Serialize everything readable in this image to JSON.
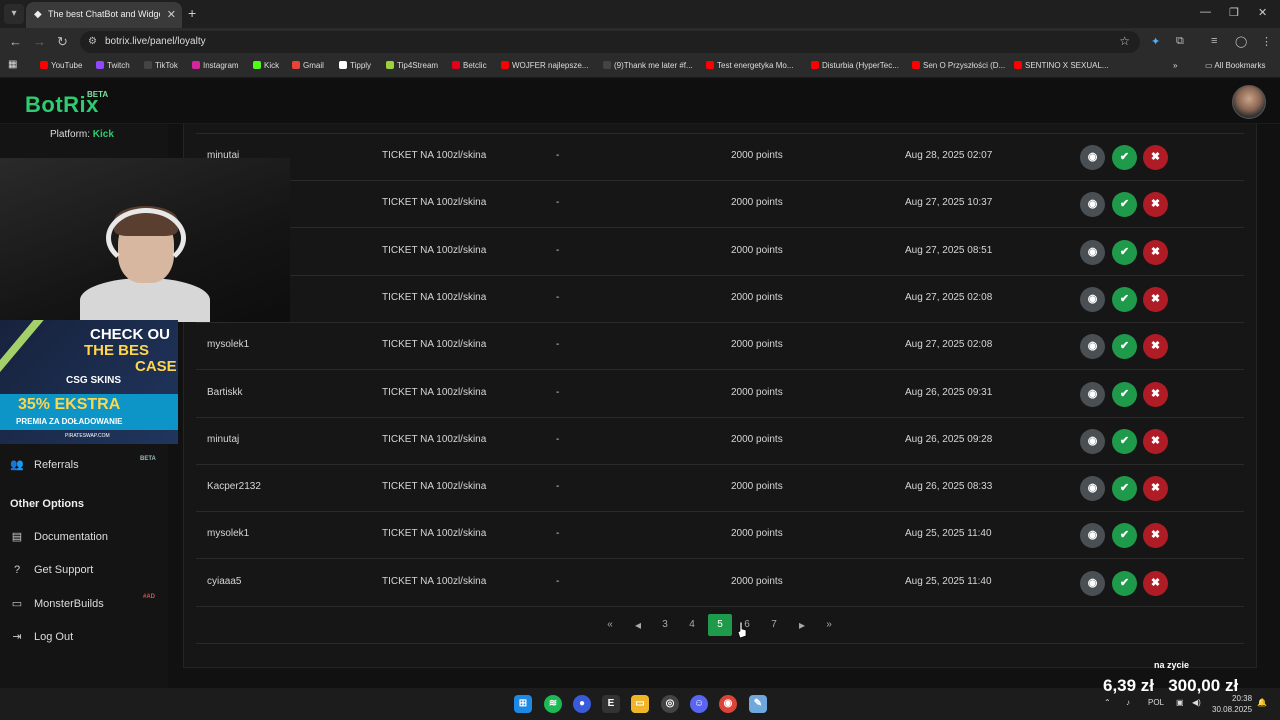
{
  "browser": {
    "tab_title": "The best ChatBot and Widgets",
    "url": "botrix.live/panel/loyalty",
    "all_bookmarks": "All Bookmarks",
    "bookmarks": [
      {
        "label": "YouTube",
        "color": "#ff0000"
      },
      {
        "label": "Twitch",
        "color": "#9146ff"
      },
      {
        "label": "TikTok",
        "color": "#222222"
      },
      {
        "label": "Instagram",
        "color": "#d6249f"
      },
      {
        "label": "Kick",
        "color": "#53fc18"
      },
      {
        "label": "Gmail",
        "color": "#ea4335"
      },
      {
        "label": "Tipply",
        "color": "#ffffff"
      },
      {
        "label": "Tip4Stream",
        "color": "#9bd23a"
      },
      {
        "label": "Betclic",
        "color": "#e2001a"
      },
      {
        "label": "WOJFER najlepsze...",
        "color": "#ff0000"
      },
      {
        "label": "(9)Thank me later #f...",
        "color": "#222222"
      },
      {
        "label": "Test energetyka Mo...",
        "color": "#ff0000"
      },
      {
        "label": "Disturbia (HyperTec...",
        "color": "#ff0000"
      },
      {
        "label": "Sen O Przyszłości (D...",
        "color": "#ff0000"
      },
      {
        "label": "SENTINO X SEXUAL...",
        "color": "#ff0000"
      }
    ]
  },
  "app": {
    "logo": "BotRix",
    "logo_badge": "BETA",
    "platform_label": "Platform:",
    "platform_value": "Kick"
  },
  "ad": {
    "line1": "CHECK OU",
    "line2": "THE BES",
    "line3": "CASE",
    "brand": "CSG SKINS",
    "promo": "35% EKSTRA",
    "promo_sub": "PREMIA ZA DOŁADOWANIE",
    "footer": "PIRATESWAP.COM"
  },
  "sidebar": {
    "referrals": "Referrals",
    "referrals_badge": "BETA",
    "other_options": "Other Options",
    "documentation": "Documentation",
    "get_support": "Get Support",
    "monsterbuilds": "MonsterBuilds",
    "monsterbuilds_badge": "#AD",
    "log_out": "Log Out"
  },
  "table": {
    "rows": [
      {
        "user": "minutaj",
        "reward": "TICKET NA 100zl/skina",
        "input": "-",
        "cost": "2000 points",
        "date": "Aug 28, 2025 02:07"
      },
      {
        "user": "",
        "reward": "TICKET NA 100zl/skina",
        "input": "-",
        "cost": "2000 points",
        "date": "Aug 27, 2025 10:37"
      },
      {
        "user": "",
        "reward": "TICKET NA 100zl/skina",
        "input": "-",
        "cost": "2000 points",
        "date": "Aug 27, 2025 08:51"
      },
      {
        "user": "",
        "reward": "TICKET NA 100zl/skina",
        "input": "-",
        "cost": "2000 points",
        "date": "Aug 27, 2025 02:08"
      },
      {
        "user": "mysolek1",
        "reward": "TICKET NA 100zl/skina",
        "input": "-",
        "cost": "2000 points",
        "date": "Aug 27, 2025 02:08"
      },
      {
        "user": "Bartiskk",
        "reward": "TICKET NA 100zl/skina",
        "input": "-",
        "cost": "2000 points",
        "date": "Aug 26, 2025 09:31"
      },
      {
        "user": "minutaj",
        "reward": "TICKET NA 100zl/skina",
        "input": "-",
        "cost": "2000 points",
        "date": "Aug 26, 2025 09:28"
      },
      {
        "user": "Kacper2132",
        "reward": "TICKET NA 100zl/skina",
        "input": "-",
        "cost": "2000 points",
        "date": "Aug 26, 2025 08:33"
      },
      {
        "user": "mysolek1",
        "reward": "TICKET NA 100zl/skina",
        "input": "-",
        "cost": "2000 points",
        "date": "Aug 25, 2025 11:40"
      },
      {
        "user": "cyiaaa5",
        "reward": "TICKET NA 100zl/skina",
        "input": "-",
        "cost": "2000 points",
        "date": "Aug 25, 2025 11:40"
      }
    ]
  },
  "pagination": {
    "pages": [
      "3",
      "4",
      "5",
      "6",
      "7"
    ],
    "current": "5"
  },
  "overlay": {
    "label": "na zycie",
    "current": "6,39 zł",
    "goal": "300,00 zł"
  },
  "taskbar": {
    "language": "POL",
    "time": "20:38",
    "date": "30.08.2025"
  },
  "colors": {
    "accent": "#2ecc71",
    "approve": "#1f9a4a",
    "reject": "#b01c25",
    "view": "#4a4f54"
  }
}
